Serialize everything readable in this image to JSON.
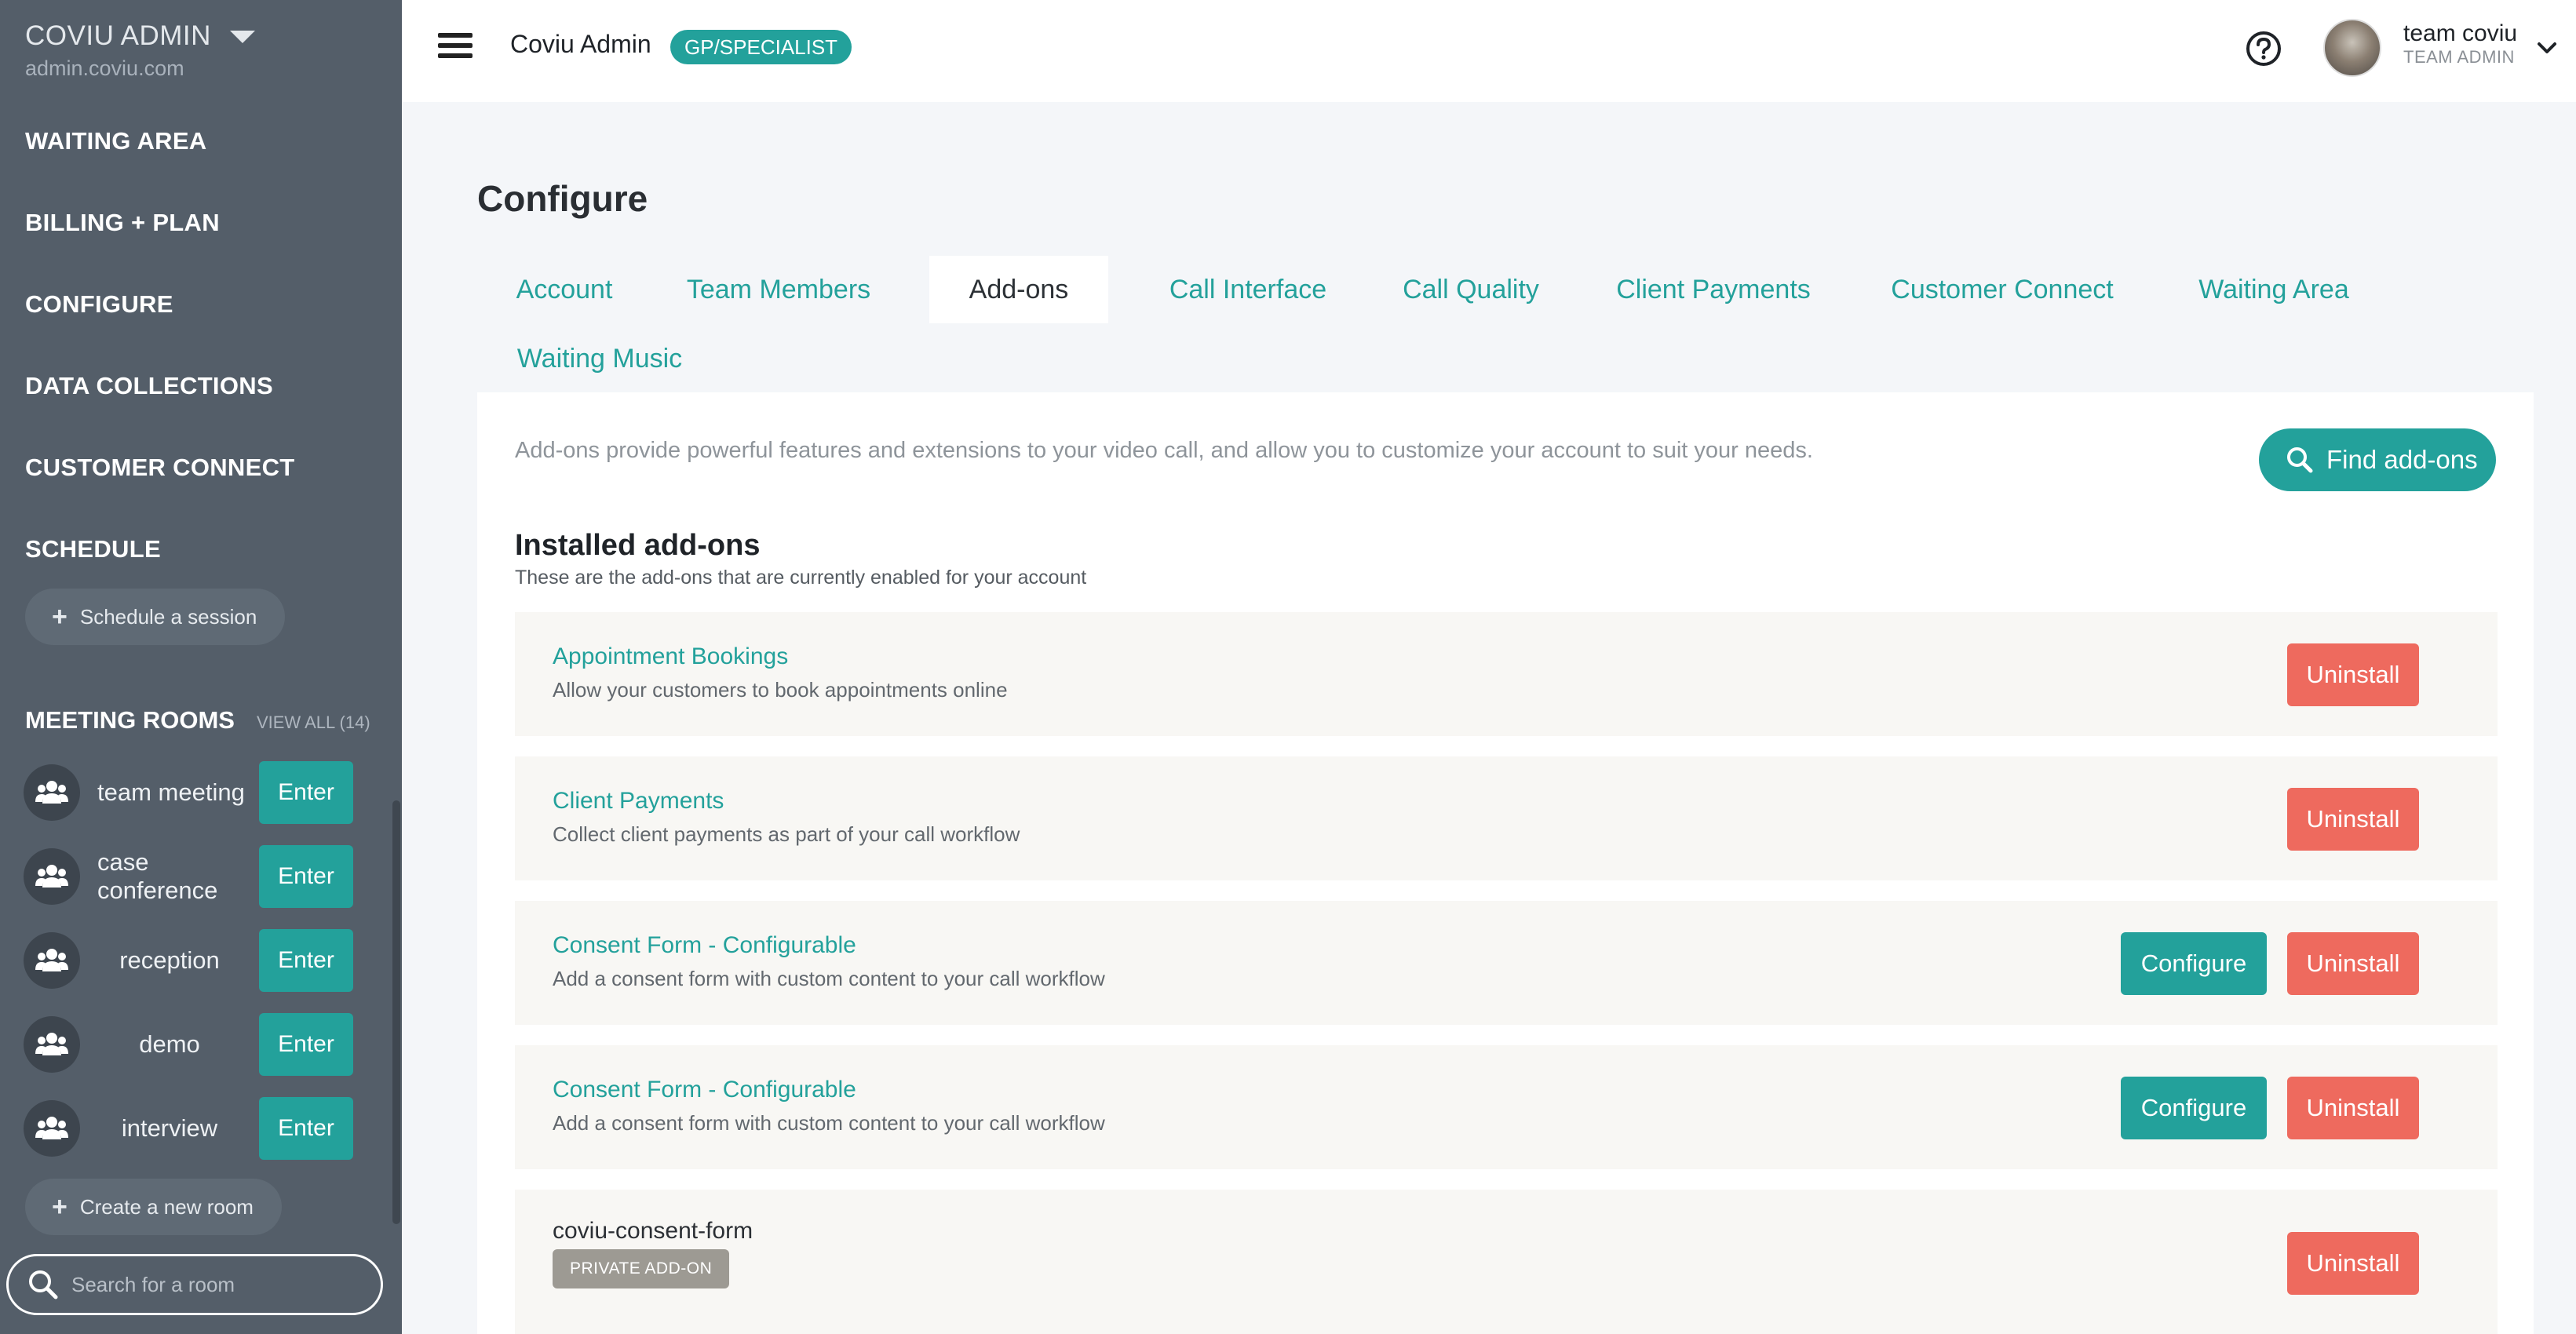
{
  "sidebar": {
    "brand": "COVIU ADMIN",
    "domain": "admin.coviu.com",
    "nav": [
      {
        "label": "WAITING AREA"
      },
      {
        "label": "BILLING + PLAN"
      },
      {
        "label": "CONFIGURE"
      },
      {
        "label": "DATA COLLECTIONS"
      },
      {
        "label": "CUSTOMER CONNECT"
      },
      {
        "label": "SCHEDULE"
      }
    ],
    "schedule_button": "Schedule a session",
    "meeting_rooms": {
      "title": "MEETING ROOMS",
      "view_all": "VIEW ALL (14)",
      "enter_label": "Enter",
      "rooms": [
        {
          "name": "team meeting"
        },
        {
          "name": "case conference"
        },
        {
          "name": "reception"
        },
        {
          "name": "demo"
        },
        {
          "name": "interview"
        }
      ]
    },
    "create_room_button": "Create a new room",
    "search_placeholder": "Search for a room"
  },
  "topbar": {
    "app_title": "Coviu Admin",
    "role_badge": "GP/SPECIALIST",
    "user_name": "team coviu",
    "user_role": "TEAM ADMIN"
  },
  "main": {
    "title": "Configure",
    "tabs": [
      {
        "label": "Account"
      },
      {
        "label": "Team Members"
      },
      {
        "label": "Add-ons",
        "active": true
      },
      {
        "label": "Call Interface"
      },
      {
        "label": "Call Quality"
      },
      {
        "label": "Client Payments"
      },
      {
        "label": "Customer Connect"
      },
      {
        "label": "Waiting Area"
      },
      {
        "label": "Waiting Music"
      }
    ],
    "intro": "Add-ons provide powerful features and extensions to your video call, and allow you to customize your account to suit your needs.",
    "find_addons": "Find add-ons",
    "installed_title": "Installed add-ons",
    "installed_subtitle": "These are the add-ons that are currently enabled for your account",
    "configure_label": "Configure",
    "uninstall_label": "Uninstall",
    "addons": [
      {
        "name": "Appointment Bookings",
        "description": "Allow your customers to book appointments online"
      },
      {
        "name": "Client Payments",
        "description": "Collect client payments as part of your call workflow"
      },
      {
        "name": "Consent Form - Configurable",
        "description": "Add a consent form with custom content to your call workflow"
      },
      {
        "name": "Consent Form - Configurable",
        "description": "Add a consent form with custom content to your call workflow"
      },
      {
        "name": "coviu-consent-form",
        "badge": "PRIVATE ADD-ON"
      }
    ]
  },
  "colors": {
    "sidebar_bg": "#545e69",
    "accent_teal": "#23a19b",
    "danger_red": "#ee6a5e",
    "page_bg": "#f4f6f9"
  },
  "icons": {
    "menu": "hamburger-icon",
    "help": "help-circle-icon",
    "user_menu": "chevron-down-icon",
    "search": "search-icon",
    "add": "plus-icon",
    "room": "group-icon"
  }
}
